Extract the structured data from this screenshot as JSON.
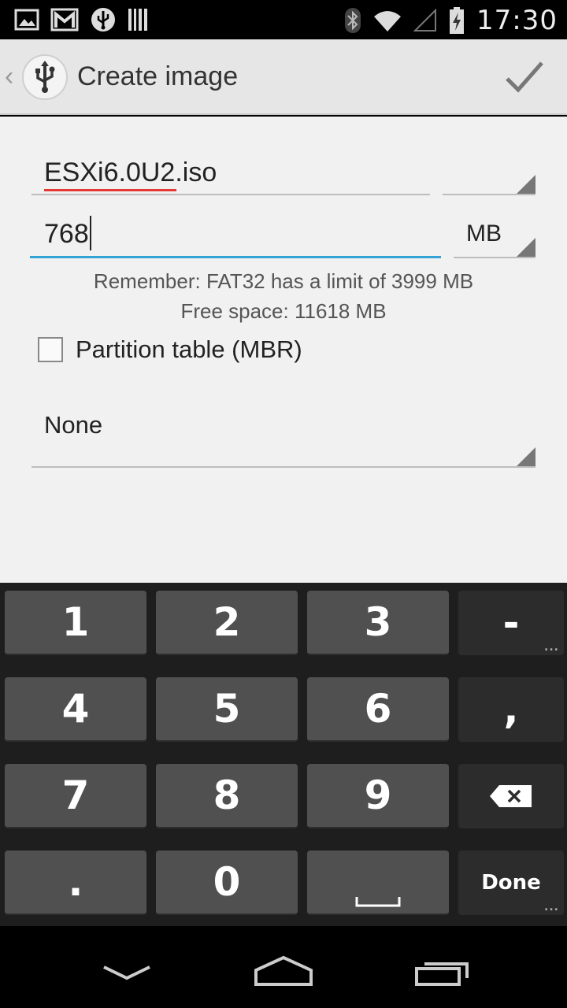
{
  "status_bar": {
    "time": "17:30",
    "left_icons": [
      "image-icon",
      "gmail-icon",
      "usb-icon",
      "barcode-icon"
    ],
    "right_icons": [
      "bluetooth-icon",
      "wifi-icon",
      "signal-icon",
      "battery-charging-icon"
    ]
  },
  "action_bar": {
    "title": "Create image",
    "back_glyph": "‹",
    "icons": {
      "app": "usb-icon",
      "confirm": "checkmark-icon"
    }
  },
  "form": {
    "filename": "ESXi6.0U2.iso",
    "size_value": "768",
    "size_unit": "MB",
    "info_limit": "Remember: FAT32 has a limit of 3999 MB",
    "info_free": "Free space: 11618 MB",
    "partition_label": "Partition table (MBR)",
    "partition_checked": false,
    "filesystem_value": "None"
  },
  "keyboard": {
    "rows": [
      [
        "1",
        "2",
        "3",
        "-"
      ],
      [
        "4",
        "5",
        "6",
        ","
      ],
      [
        "7",
        "8",
        "9",
        "⌫"
      ],
      [
        ".",
        "0",
        "␣",
        "Done"
      ]
    ],
    "done_label": "Done"
  },
  "nav_bar": {
    "icons": [
      "back-chevron-icon",
      "home-icon",
      "recents-icon"
    ]
  },
  "colors": {
    "accent": "#33a3d6",
    "spellcheck": "#e53935",
    "background": "#f1f1f1",
    "keyboard": "#1e1e1e"
  }
}
